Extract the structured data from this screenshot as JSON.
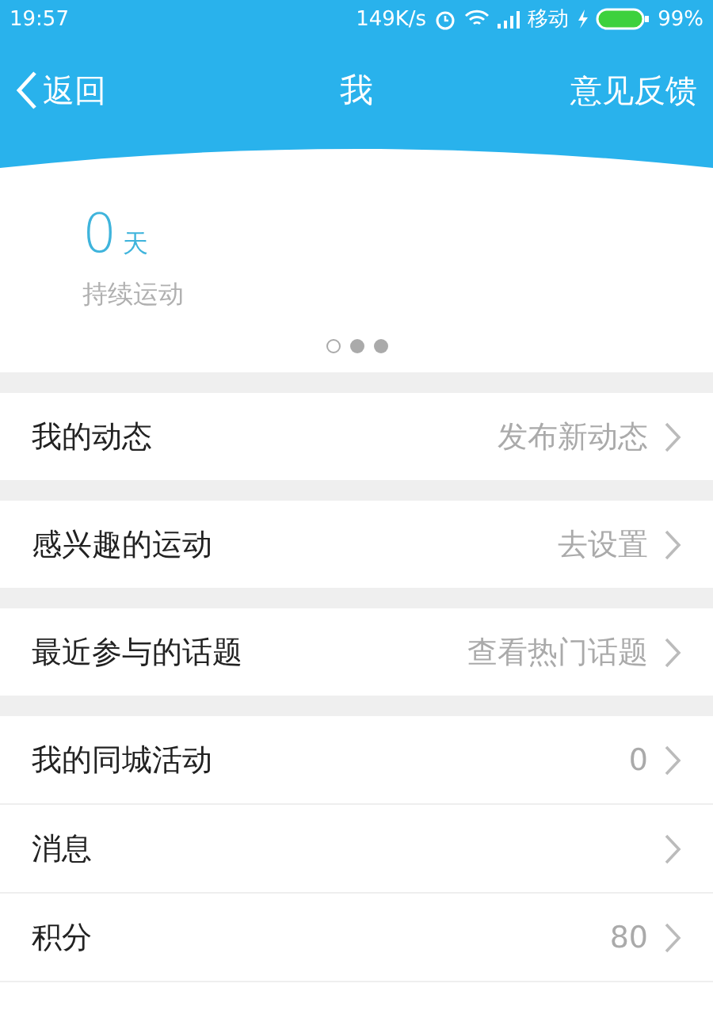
{
  "status_bar": {
    "time": "19:57",
    "speed": "149K/s",
    "carrier": "移动",
    "battery": "99%"
  },
  "header": {
    "back": "返回",
    "title": "我",
    "action": "意见反馈"
  },
  "streak": {
    "value": "0",
    "unit": "天",
    "label": "持续运动",
    "pages": [
      {
        "selected": true
      },
      {
        "selected": false
      },
      {
        "selected": false
      }
    ]
  },
  "sections": [
    [
      {
        "label": "我的动态",
        "detail": "发布新动态"
      }
    ],
    [
      {
        "label": "感兴趣的运动",
        "detail": "去设置"
      }
    ],
    [
      {
        "label": "最近参与的话题",
        "detail": "查看热门话题"
      }
    ],
    [
      {
        "label": "我的同城活动",
        "detail": "0"
      },
      {
        "label": "消息"
      },
      {
        "label": "积分",
        "detail": "80"
      }
    ]
  ]
}
